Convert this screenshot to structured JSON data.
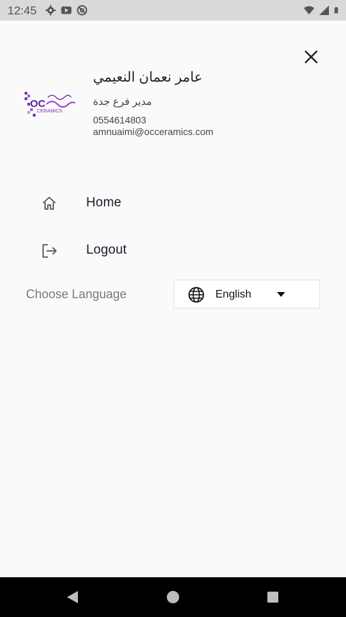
{
  "status_bar": {
    "time": "12:45",
    "left_icons": [
      "gear-icon",
      "youtube-icon",
      "no-disturb-icon"
    ],
    "right_icons": [
      "wifi-icon",
      "signal-icon",
      "battery-icon"
    ]
  },
  "profile": {
    "logo_text": "OC CERAMICS",
    "name": "عامر نعمان النعيمي",
    "role": "مدير فرع جدة",
    "phone": "0554614803",
    "email": "amnuaimi@occeramics.com"
  },
  "menu": {
    "home_label": "Home",
    "logout_label": "Logout"
  },
  "language": {
    "label": "Choose Language",
    "selected": "English"
  },
  "colors": {
    "status_bar": "#d9d9d9",
    "background": "#fafafa",
    "logo_accent": "#7b2fbe",
    "nav_bar": "#000000"
  }
}
